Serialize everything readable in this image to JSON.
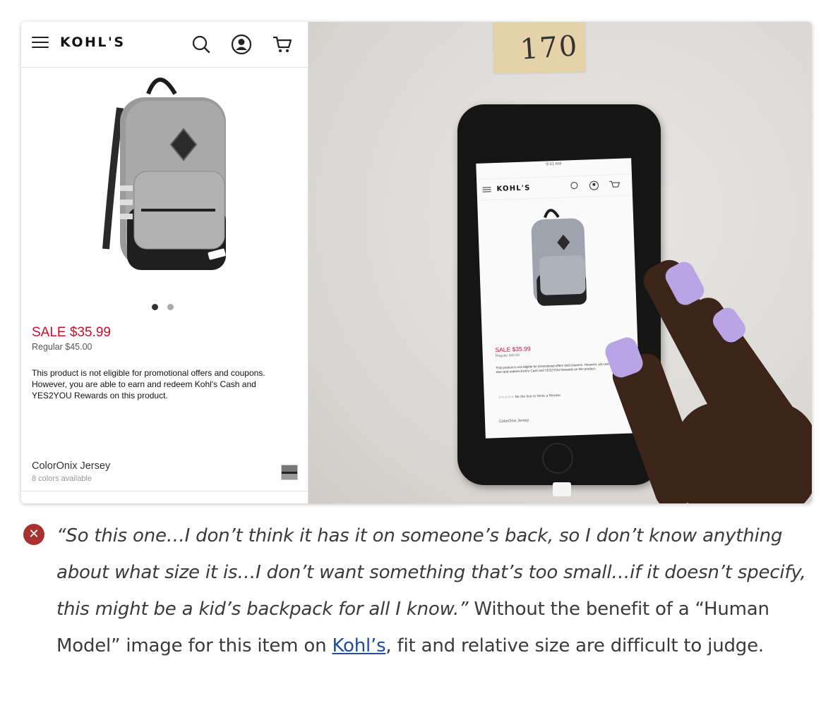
{
  "screenshot": {
    "brand": "KOHL'S",
    "header_icons": [
      "menu-icon",
      "search-icon",
      "account-icon",
      "cart-icon"
    ],
    "carousel_dots": 2,
    "sale_price": "SALE $35.99",
    "regular_price": "Regular $45.00",
    "promo_text": "This product is not eligible for promotional offers and coupons. However, you are able to earn and redeem Kohl's Cash and YES2YOU Rewards on this product.",
    "color_name": "ColorOnix Jersey",
    "color_count": "8 colors available"
  },
  "photo": {
    "sticky_note": "170",
    "phone_screen": {
      "status": "9:41 AM",
      "brand": "KOHL'S",
      "sale": "SALE $35.99",
      "regular": "Regular $45.00",
      "promo": "This product is not eligible for promotional offers and coupons. However, you are able to earn and redeem Kohl's Cash and YES2YOU Rewards on this product.",
      "review": "☆☆☆☆☆  Be the first to Write a Review",
      "color": "ColorOnix Jersey"
    }
  },
  "caption": {
    "quote": "“So this one…I don’t think it has it on someone’s back, so I don’t know anything about what size it is…I don’t want something that’s too small…if it doesn’t specify, this might be a kid’s backpack for all I know.”",
    "text_before_link": " Without the benefit of a “Human Model” image for this item on ",
    "link": "Kohl’s",
    "text_after_link": ", fit and relative size are difficult to judge."
  },
  "colors": {
    "sale_red": "#c8102e",
    "error_icon": "#a83232",
    "link_blue": "#1a4fa0",
    "nail_lavender": "#b9a4e6"
  }
}
